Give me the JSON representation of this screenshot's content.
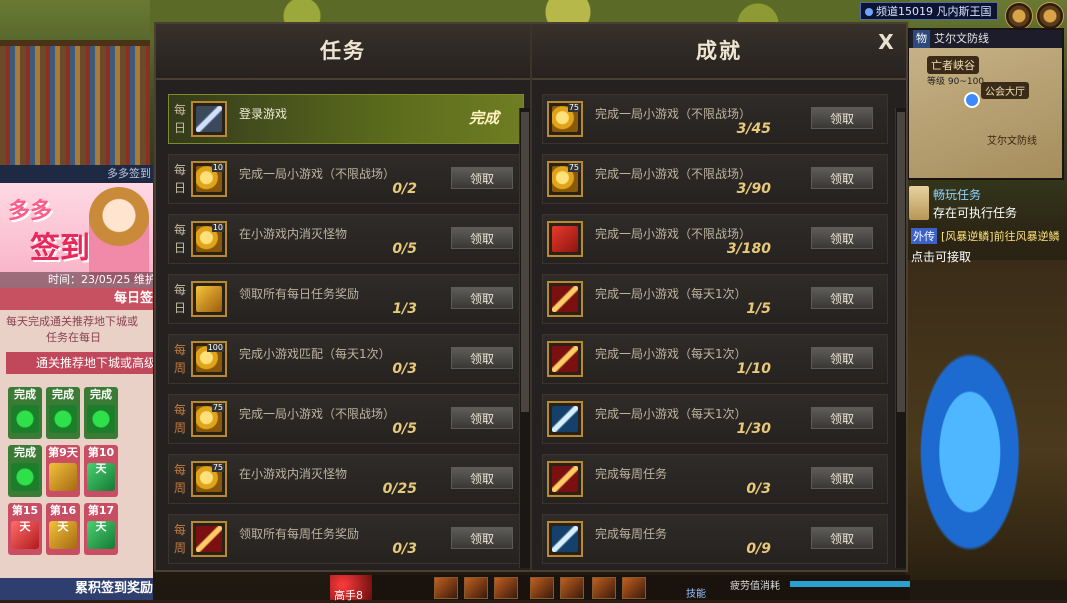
{
  "hud_top": {
    "channel": "频道15019 凡内斯王国"
  },
  "minimap": {
    "tab1": "物",
    "tab2": "艾尔文防线",
    "location1": "亡者峡谷",
    "level": "等级 90~100",
    "location2": "公会大厅",
    "location3": "艾尔文防线"
  },
  "tracker": {
    "title": "畅玩任务",
    "subtitle": "存在可执行任务",
    "tag": "外传",
    "quest": "[风暴逆鳞]前往风暴逆鳞",
    "hint": "点击可接取"
  },
  "signin": {
    "top_text": "多多签到",
    "banner_small": "多多",
    "banner_big": "签到",
    "time": "时间：23/05/25 维护",
    "daily_title": "每日签",
    "desc_line1": "每天完成通关推荐地下城或",
    "desc_line2": "任务在每日",
    "bar_text": "通关推荐地下城或高级",
    "cells": [
      {
        "label": "完成",
        "state": "done"
      },
      {
        "label": "完成",
        "state": "done"
      },
      {
        "label": "完成",
        "state": "done"
      },
      {
        "label": "完成",
        "state": "done"
      },
      {
        "label": "第9天",
        "state": "pend"
      },
      {
        "label": "第10天",
        "state": "pend-green"
      },
      {
        "label": "第15天",
        "state": "pend-red"
      },
      {
        "label": "第16天",
        "state": "pend"
      },
      {
        "label": "第17天",
        "state": "pend-green"
      }
    ],
    "footer": "累积签到奖励"
  },
  "bottom_hud": {
    "name": "高手8",
    "skill_label": "技能",
    "fatigue": "疲劳值消耗"
  },
  "window": {
    "close_label": "X",
    "tasks": {
      "header": "任务",
      "rows": [
        {
          "period": [
            "每",
            "日"
          ],
          "type": "daily",
          "icon": "sword",
          "num": "",
          "title": "登录游戏",
          "progress": "",
          "status": "完成",
          "complete": true
        },
        {
          "period": [
            "每",
            "日"
          ],
          "type": "daily",
          "icon": "coin",
          "num": "10",
          "title": "完成一局小游戏（不限战场）",
          "progress": "0/2",
          "button": "领取"
        },
        {
          "period": [
            "每",
            "日"
          ],
          "type": "daily",
          "icon": "coin",
          "num": "10",
          "title": "在小游戏内消灭怪物",
          "progress": "0/5",
          "button": "领取"
        },
        {
          "period": [
            "每",
            "日"
          ],
          "type": "daily",
          "icon": "chest",
          "num": "",
          "title": "领取所有每日任务奖励",
          "progress": "1/3",
          "button": "领取"
        },
        {
          "period": [
            "每",
            "周"
          ],
          "type": "weekly",
          "icon": "coin",
          "num": "100",
          "title": "完成小游戏匹配（每天1次）",
          "progress": "0/3",
          "button": "领取"
        },
        {
          "period": [
            "每",
            "周"
          ],
          "type": "weekly",
          "icon": "coin",
          "num": "75",
          "title": "完成一局小游戏（不限战场）",
          "progress": "0/5",
          "button": "领取"
        },
        {
          "period": [
            "每",
            "周"
          ],
          "type": "weekly",
          "icon": "coin",
          "num": "75",
          "title": "在小游戏内消灭怪物",
          "progress": "0/25",
          "button": "领取"
        },
        {
          "period": [
            "每",
            "周"
          ],
          "type": "weekly",
          "icon": "redsword",
          "num": "",
          "title": "领取所有每周任务奖励",
          "progress": "0/3",
          "button": "领取"
        }
      ]
    },
    "achievements": {
      "header": "成就",
      "rows": [
        {
          "icon": "coin",
          "num": "75",
          "title": "完成一局小游戏（不限战场）",
          "progress": "3/45",
          "button": "领取"
        },
        {
          "icon": "coin",
          "num": "75",
          "title": "完成一局小游戏（不限战场）",
          "progress": "3/90",
          "button": "领取"
        },
        {
          "icon": "gift",
          "num": "",
          "title": "完成一局小游戏（不限战场）",
          "progress": "3/180",
          "button": "领取"
        },
        {
          "icon": "redsword",
          "num": "",
          "title": "完成一局小游戏（每天1次）",
          "progress": "1/5",
          "button": "领取"
        },
        {
          "icon": "redsword",
          "num": "",
          "title": "完成一局小游戏（每天1次）",
          "progress": "1/10",
          "button": "领取"
        },
        {
          "icon": "bluesword",
          "num": "",
          "title": "完成一局小游戏（每天1次）",
          "progress": "1/30",
          "button": "领取"
        },
        {
          "icon": "redsword",
          "num": "",
          "title": "完成每周任务",
          "progress": "0/3",
          "button": "领取"
        },
        {
          "icon": "bluesword",
          "num": "",
          "title": "完成每周任务",
          "progress": "0/9",
          "button": "领取"
        }
      ]
    }
  }
}
